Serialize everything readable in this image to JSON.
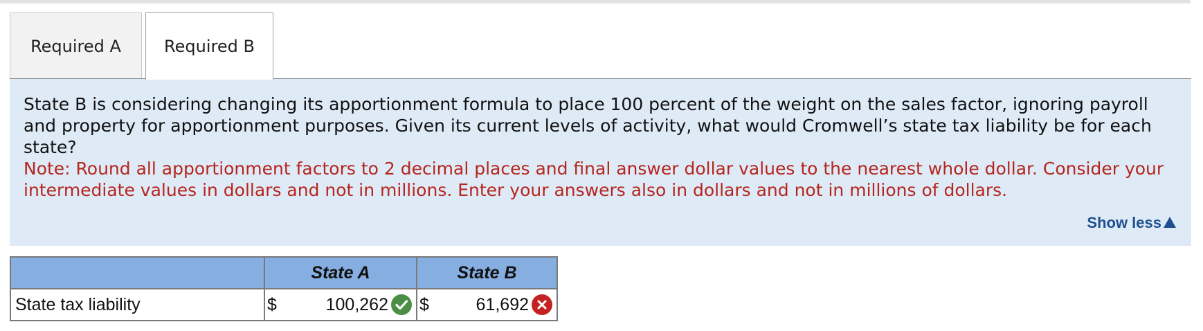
{
  "tabs": [
    {
      "label": "Required A",
      "active": false
    },
    {
      "label": "Required B",
      "active": true
    }
  ],
  "instructions": {
    "question": "State B is considering changing its apportionment formula to place 100 percent of the weight on the sales factor, ignoring payroll and property for apportionment purposes. Given its current levels of activity, what would Cromwell’s state tax liability be for each state?",
    "note": "Note: Round all apportionment factors to 2 decimal places and final answer dollar values to the nearest whole dollar. Consider your intermediate values in dollars and not in millions. Enter your answers also in dollars and not in millions of dollars.",
    "show_less_label": "Show less"
  },
  "table": {
    "headers": [
      "",
      "State A",
      "State B"
    ],
    "rows": [
      {
        "label": "State tax liability",
        "state_a": {
          "currency": "$",
          "value": "100,262",
          "status": "correct"
        },
        "state_b": {
          "currency": "$",
          "value": "61,692",
          "status": "incorrect"
        }
      }
    ]
  },
  "colors": {
    "panel_background": "#dfeaf7",
    "note_text": "#b5261e",
    "link": "#1f4f8f",
    "table_header": "#86aee0",
    "correct_badge": "#4b8f47",
    "incorrect_badge": "#c32222"
  }
}
